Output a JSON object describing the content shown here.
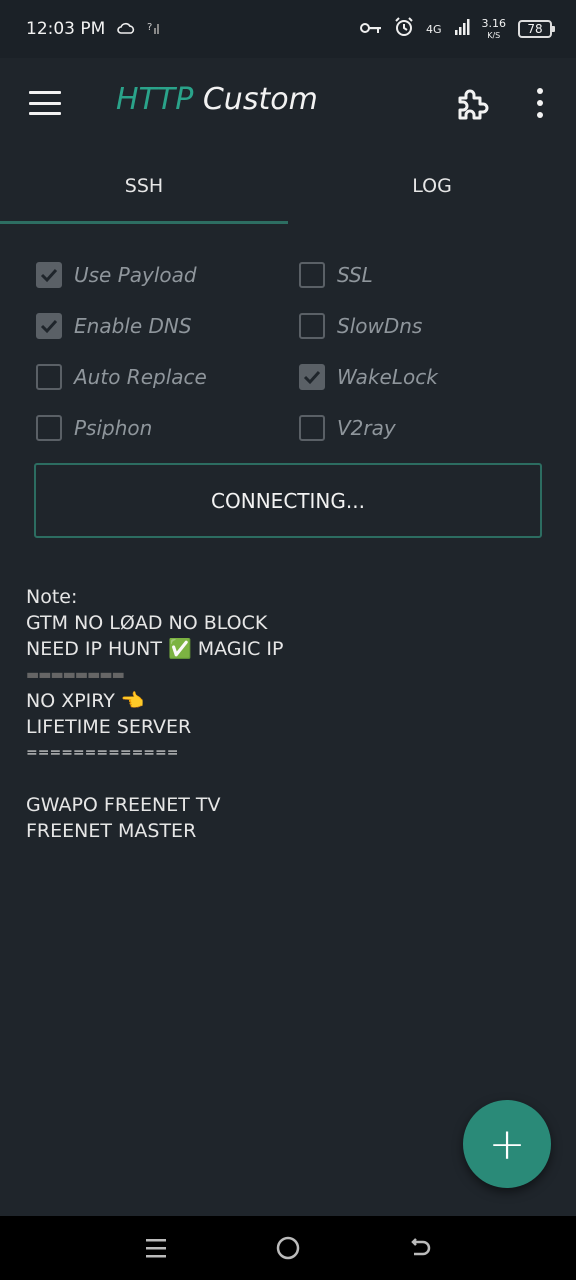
{
  "status_bar": {
    "time": "12:03 PM",
    "network": "4G",
    "speed_value": "3.16",
    "speed_unit": "K/S",
    "battery": "78"
  },
  "app_bar": {
    "title_part1": "HTTP",
    "title_part2": "Custom",
    "menu_icon": "hamburger-icon",
    "plugin_icon": "puzzle-icon",
    "more_icon": "more-vert-icon"
  },
  "tabs": [
    {
      "label": "SSH",
      "active": true
    },
    {
      "label": "LOG",
      "active": false
    }
  ],
  "options": {
    "use_payload": {
      "label": "Use Payload",
      "checked": true
    },
    "ssl": {
      "label": "SSL",
      "checked": false
    },
    "enable_dns": {
      "label": "Enable DNS",
      "checked": true
    },
    "slowdns": {
      "label": "SlowDns",
      "checked": false
    },
    "auto_replace": {
      "label": "Auto Replace",
      "checked": false
    },
    "wakelock": {
      "label": "WakeLock",
      "checked": true
    },
    "psiphon": {
      "label": "Psiphon",
      "checked": false
    },
    "v2ray": {
      "label": "V2ray",
      "checked": false
    }
  },
  "connect_button": {
    "label": "CONNECTING..."
  },
  "note": {
    "lines": [
      "Note:",
      "GTM NO LØAD NO BLOCK",
      "NEED IP HUNT ✅ MAGIC IP",
      "▬▬▬▬▬▬▬▬",
      "NO XPIRY 👈",
      "LIFETIME SERVER",
      "=============",
      "",
      "GWAPO FREENET TV",
      "FREENET MASTER"
    ]
  },
  "fab": {
    "label": "+"
  },
  "colors": {
    "accent": "#2a8a78",
    "background": "#1f252b",
    "checkbox": "#5a6066"
  }
}
